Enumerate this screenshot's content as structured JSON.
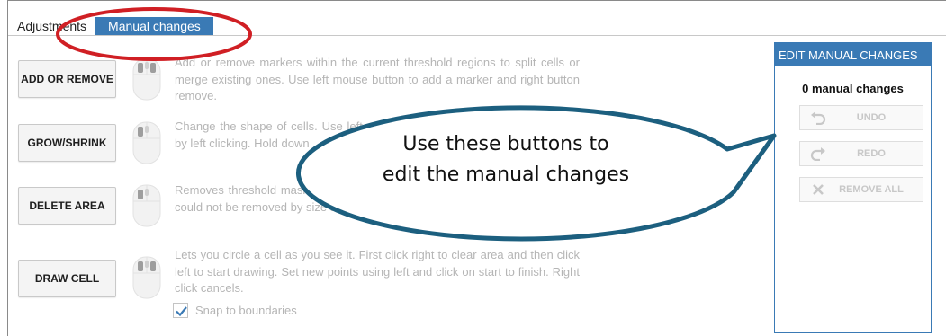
{
  "tabs": [
    {
      "label": "Adjustments",
      "active": false
    },
    {
      "label": "Manual changes",
      "active": true
    }
  ],
  "tools": [
    {
      "label": "ADD OR REMOVE",
      "description": "Add or remove markers within the current threshold regions to split cells or merge existing ones. Use left mouse button to add a marker and right button remove.",
      "mouse_icon": "mouse-both-buttons-icon"
    },
    {
      "label": "GROW/SHRINK",
      "description": "Change the shape of cells. Use left mouse button to select. Size is adjusted by left clicking. Hold down",
      "mouse_icon": "mouse-left-button-icon"
    },
    {
      "label": "DELETE AREA",
      "description": "Removes threshold mask in selected area. Use to remove small objects that could not be removed by size adjustment. Use left mouse button to select.",
      "mouse_icon": "mouse-left-button-icon"
    },
    {
      "label": "DRAW CELL",
      "description": "Lets you circle a cell as you see it. First click right to clear area and then click left to start drawing. Set new points using left and click on start to finish. Right click cancels.",
      "mouse_icon": "mouse-both-buttons-icon"
    }
  ],
  "snap": {
    "label": "Snap to boundaries",
    "checked": true
  },
  "panel": {
    "title": "EDIT MANUAL CHANGES",
    "count_label": "0 manual changes",
    "buttons": [
      {
        "label": "UNDO",
        "icon": "undo-icon"
      },
      {
        "label": "REDO",
        "icon": "redo-icon"
      },
      {
        "label": "REMOVE ALL",
        "icon": "close-icon"
      }
    ]
  },
  "callout": {
    "line1": "Use these buttons to",
    "line2": "edit the manual changes",
    "color": "#1c5f7f"
  },
  "highlight_color": "#d01f24",
  "accent_color": "#3a7ab5"
}
